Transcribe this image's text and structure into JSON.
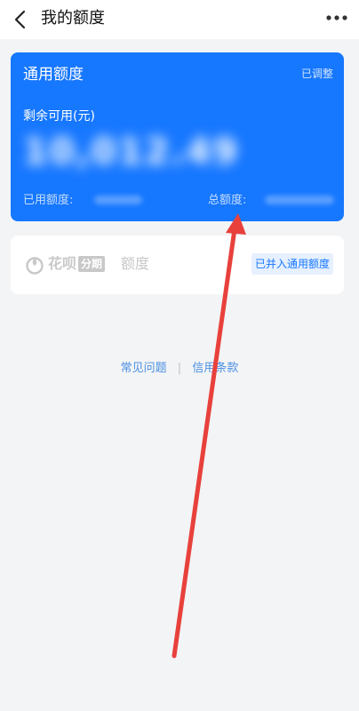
{
  "header": {
    "title": "我的额度"
  },
  "credit_card": {
    "title": "通用额度",
    "status": "已调整",
    "remaining_label": "剩余可用(元)",
    "remaining_amount": "10,012.49",
    "used_label": "已用额度:",
    "total_label": "总额度:"
  },
  "huabei_card": {
    "brand": "花呗",
    "tag": "分期",
    "suffix": "额度",
    "merged_badge": "已并入通用额度"
  },
  "footer": {
    "faq": "常见问题",
    "separator": "|",
    "terms": "信用条款"
  },
  "colors": {
    "accent": "#1677ff",
    "annotation_arrow": "#e8413c"
  }
}
